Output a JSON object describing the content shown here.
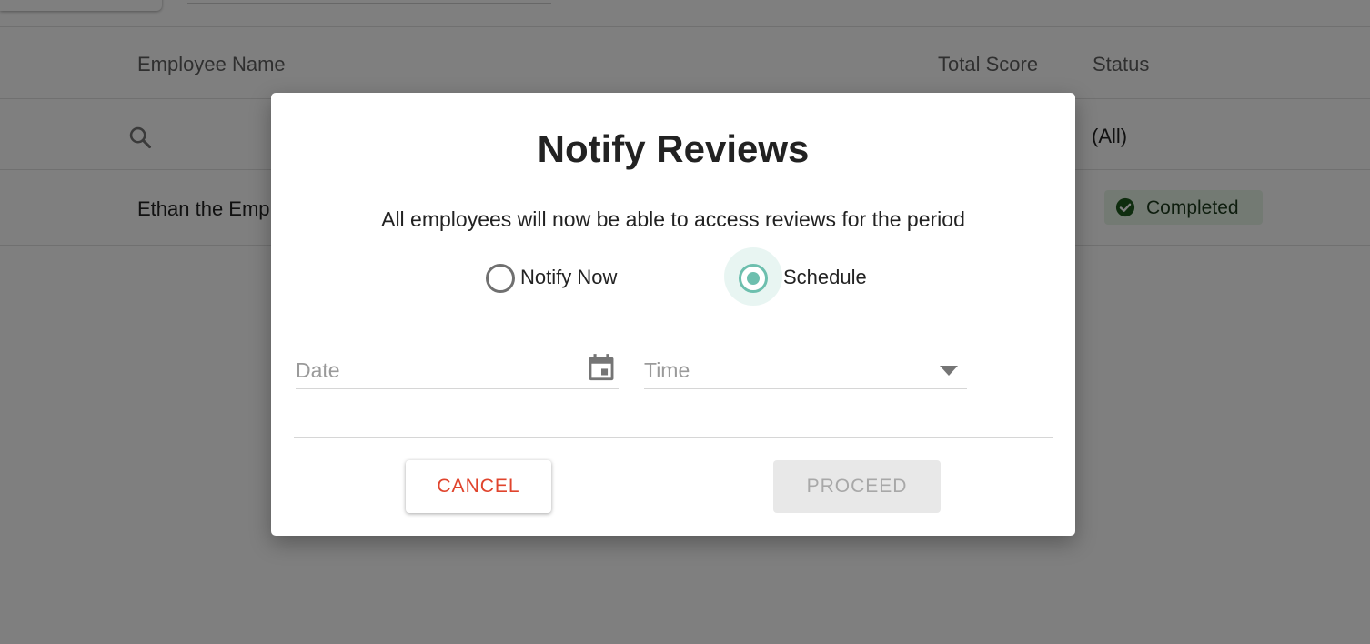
{
  "table": {
    "columns": {
      "employee_name": "Employee Name",
      "total_score": "Total Score",
      "status": "Status"
    },
    "filters": {
      "status_value": "(All)"
    },
    "rows": [
      {
        "employee_name": "Ethan the Employee",
        "status": "Completed"
      }
    ]
  },
  "dialog": {
    "title": "Notify Reviews",
    "message": "All employees will now be able to access reviews for the period",
    "options": [
      {
        "label": "Notify Now",
        "selected": false
      },
      {
        "label": "Schedule",
        "selected": true
      }
    ],
    "date_label": "Date",
    "time_label": "Time",
    "cancel_label": "CANCEL",
    "proceed_label": "PROCEED"
  },
  "colors": {
    "accent": "#6dbfae",
    "cancel": "#e0442d",
    "completed_badge_bg": "#e6f4e6",
    "completed_icon": "#1e5a1e"
  }
}
